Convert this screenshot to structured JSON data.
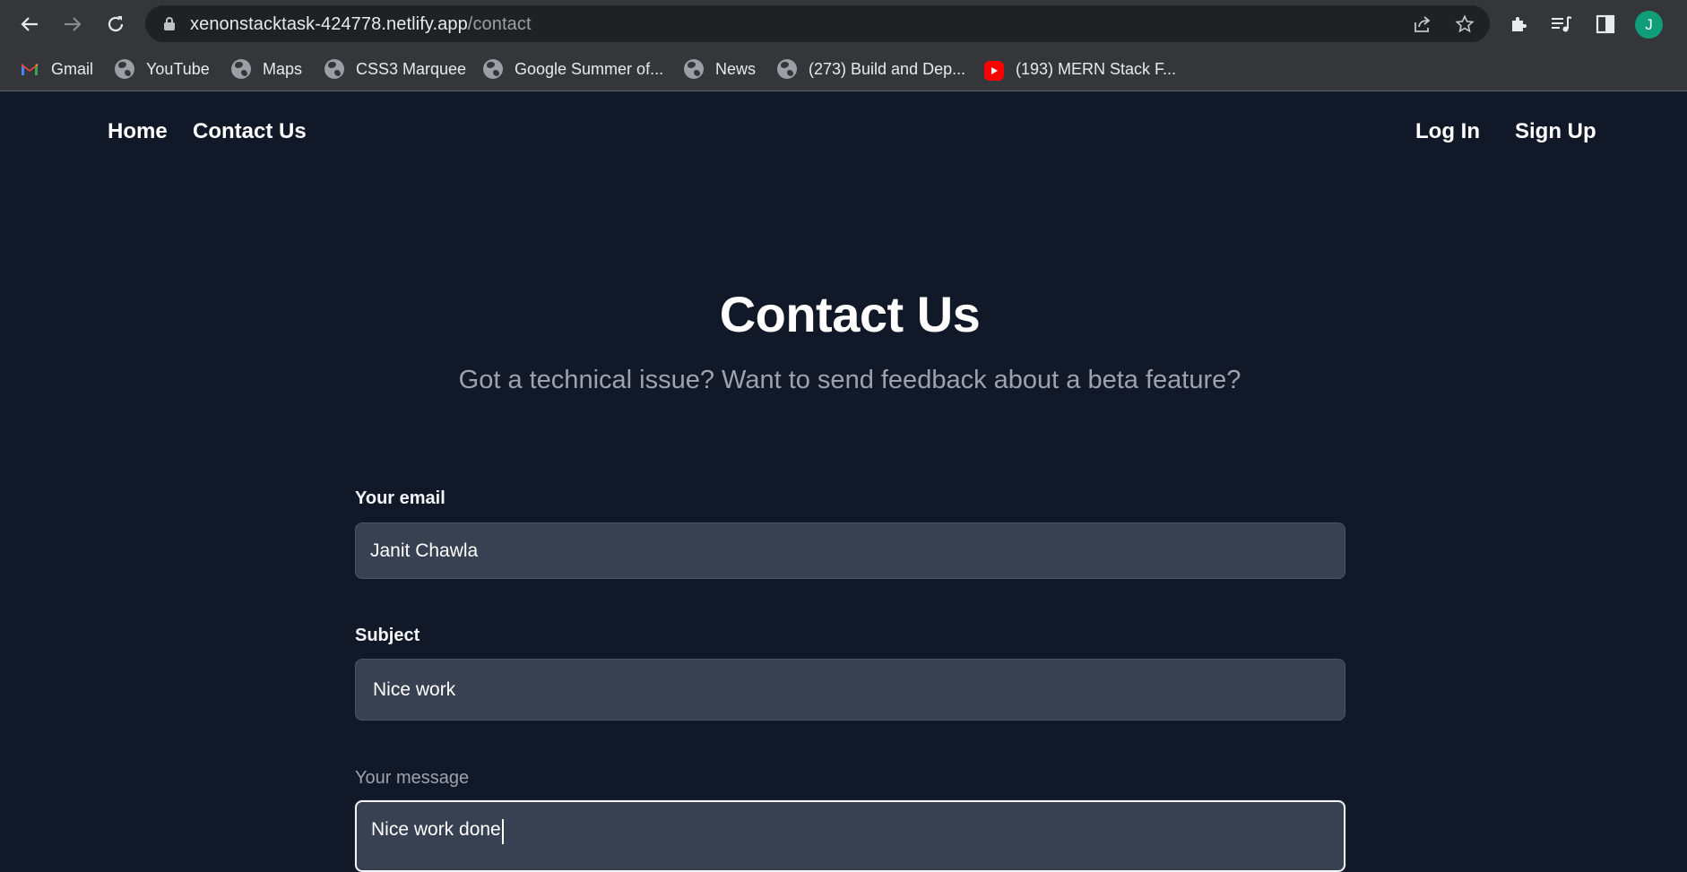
{
  "browser": {
    "url_host": "xenonstacktask-424778.netlify.app",
    "url_path": "/contact",
    "profile_initial": "J",
    "icons": {
      "back": "back-arrow-icon",
      "forward": "forward-arrow-icon",
      "reload": "reload-icon",
      "share": "share-icon",
      "bookmark_star": "star-icon",
      "extensions": "puzzle-icon",
      "media": "media-queue-icon",
      "side_panel": "side-panel-icon"
    },
    "bookmarks": [
      {
        "label": "Gmail",
        "icon": "gmail-icon"
      },
      {
        "label": "YouTube",
        "icon": "globe-icon"
      },
      {
        "label": "Maps",
        "icon": "globe-icon"
      },
      {
        "label": "CSS3 Marquee",
        "icon": "globe-icon"
      },
      {
        "label": "Google Summer of...",
        "icon": "globe-icon"
      },
      {
        "label": "News",
        "icon": "globe-icon"
      },
      {
        "label": "(273) Build and Dep...",
        "icon": "globe-icon"
      },
      {
        "label": "(193) MERN Stack F...",
        "icon": "youtube-icon"
      }
    ]
  },
  "site_nav": {
    "home": "Home",
    "contact": "Contact Us",
    "login": "Log In",
    "signup": "Sign Up"
  },
  "hero": {
    "title": "Contact Us",
    "subtitle": "Got a technical issue? Want to send feedback about a beta feature?"
  },
  "form": {
    "email_label": "Your email",
    "email_value": "Janit Chawla",
    "subject_label": "Subject",
    "subject_value": "Nice work",
    "message_label": "Your message",
    "message_value": "Nice work done"
  },
  "colors": {
    "page_bg": "#111827",
    "input_bg": "#374151",
    "chrome_bg": "#35363a",
    "avatar": "#0f9d7a"
  }
}
